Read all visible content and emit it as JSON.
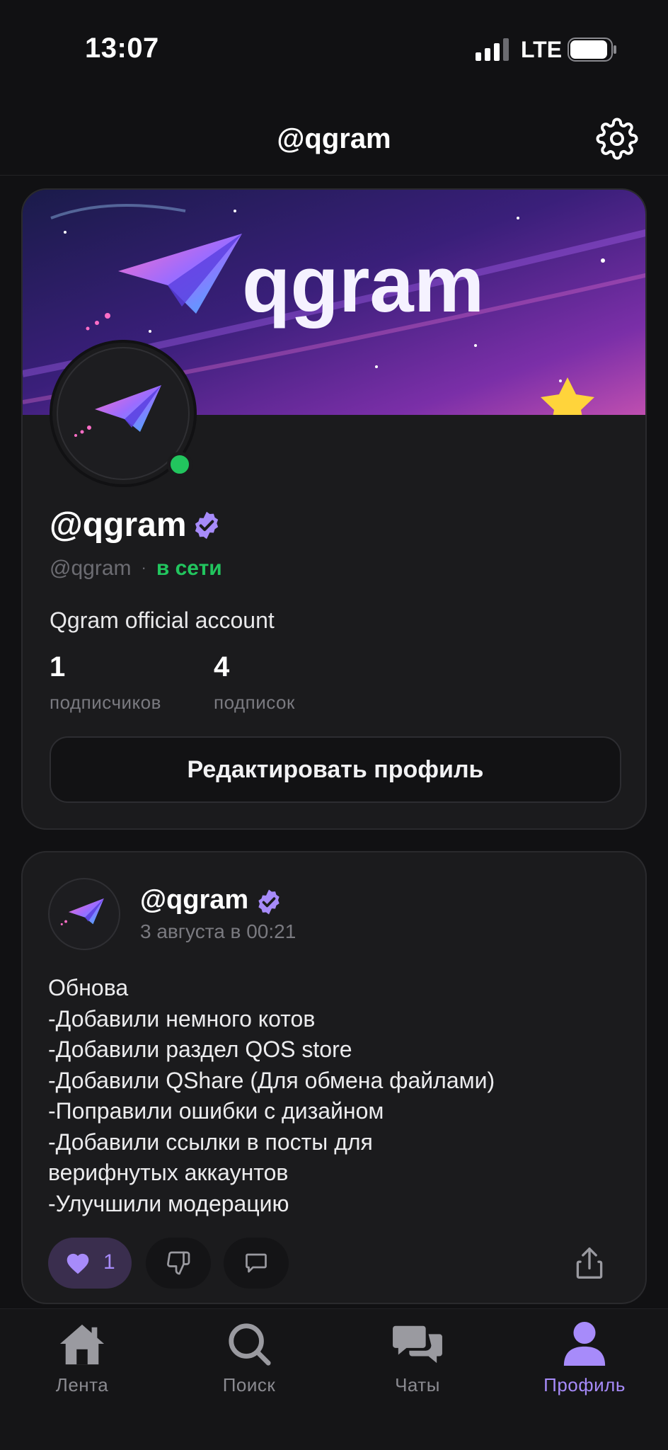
{
  "status_bar": {
    "time": "13:07",
    "network": "LTE"
  },
  "header": {
    "title": "@qgram"
  },
  "profile": {
    "banner_text": "qgram",
    "display_name": "@qgram",
    "handle": "@qgram",
    "separator": "·",
    "status": "в сети",
    "bio": "Qgram official account",
    "followers": {
      "count": "1",
      "label": "подписчиков"
    },
    "following": {
      "count": "4",
      "label": "подписок"
    },
    "edit_button": "Редактировать профиль"
  },
  "post": {
    "author": "@qgram",
    "time": "3 августа в 00:21",
    "body_lines": [
      "Обнова",
      "-Добавили немного котов",
      "-Добавили раздел QOS store",
      "-Добавили QShare (Для обмена файлами)",
      "-Поправили ошибки с дизайном",
      "-Добавили ссылки в посты для",
      "верифнутых аккаунтов",
      "-Улучшили модерацию"
    ],
    "likes": "1"
  },
  "tabs": [
    {
      "label": "Лента",
      "icon": "home-icon"
    },
    {
      "label": "Поиск",
      "icon": "search-icon"
    },
    {
      "label": "Чаты",
      "icon": "chats-icon"
    },
    {
      "label": "Профиль",
      "icon": "profile-icon",
      "active": true
    }
  ],
  "colors": {
    "accent": "#a78bfa",
    "online": "#22c55e",
    "background": "#111113",
    "card": "#1b1b1d"
  }
}
